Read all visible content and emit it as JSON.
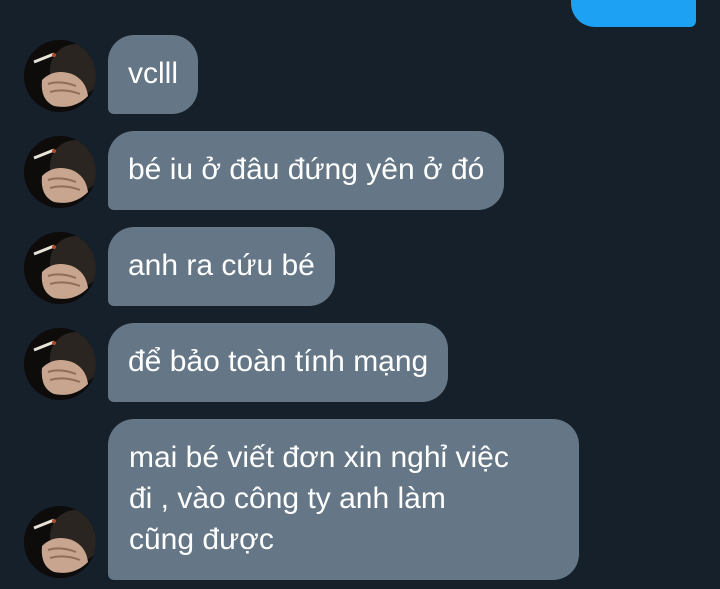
{
  "conversation": {
    "sent_partial": "",
    "messages": [
      {
        "text": "vclll"
      },
      {
        "text": "bé iu ở đâu đứng yên ở đó"
      },
      {
        "text": "anh ra cứu bé"
      },
      {
        "text": "để bảo toàn tính mạng"
      },
      {
        "lines": [
          "mai bé viết đơn xin nghỉ việc",
          "đi , vào công ty anh làm",
          "cũng được"
        ]
      }
    ]
  },
  "colors": {
    "background": "#15202b",
    "received_bubble": "#657786",
    "sent_bubble": "#1da1f2",
    "text": "#ffffff"
  },
  "icons": {
    "avatar": "profile-photo-hand-with-cigarette"
  }
}
